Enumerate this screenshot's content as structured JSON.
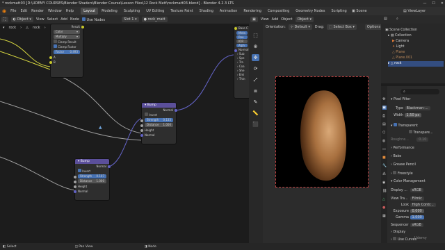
{
  "window": {
    "title": "* rockmatt03 [D:\\UDEMY COURSES\\Blender Shaders\\Blender Course\\Lesson Files\\12 Rock Matt\\rockmatt03.blend] - Blender 4.2.3 LTS",
    "min": "—",
    "max": "☐",
    "close": "✕"
  },
  "menu": {
    "items": [
      "File",
      "Edit",
      "Render",
      "Window",
      "Help"
    ],
    "workspaces": [
      "Layout",
      "Modeling",
      "Sculpting",
      "UV Editing",
      "Texture Paint",
      "Shading",
      "Animation",
      "Rendering",
      "Compositing",
      "Geometry Nodes",
      "Scripting"
    ],
    "scene": "Scene",
    "view_layer": "ViewLayer"
  },
  "node_header": {
    "editor": "Object",
    "view": "View",
    "select": "Select",
    "add": "Add",
    "node": "Node",
    "use_nodes": "Use Nodes",
    "slot": "Slot 1",
    "material": "rock_matt",
    "breadcrumb_obj": "rock",
    "breadcrumb_mesh": "rock",
    "breadcrumb_mat": "rock_matt"
  },
  "mix_node": {
    "header": "Result",
    "data_type": "Color",
    "blend": "Multiply",
    "clamp_result": "Clamp Result",
    "clamp_factor": "Clamp Factor",
    "factor_label": "Factor",
    "factor_value": "0.493",
    "in_a": "A",
    "in_b": "B"
  },
  "bump1": {
    "title": "Bump",
    "normal_out": "Normal",
    "invert": "Invert",
    "strength_label": "Strength",
    "strength_value": "0.133",
    "distance_label": "Distance",
    "distance_value": "1.000",
    "height": "Height",
    "normal_in": "Normal"
  },
  "bump2": {
    "title": "Bump",
    "normal_out": "Normal",
    "invert": "Invert",
    "strength_label": "Strength",
    "strength_value": "0.107",
    "distance_label": "Distance",
    "distance_value": "1.000",
    "height": "Height",
    "normal_in": "Normal"
  },
  "bsdf_partial": {
    "header": "Base C",
    "rows": [
      "Meta",
      "Rou",
      "IOR",
      "Alph",
      "Normal",
      "Sub",
      "Spe",
      "Tra",
      "Coa",
      "She",
      "Emi",
      "Thin"
    ]
  },
  "viewport_header": {
    "orientation_label": "Orientation:",
    "orientation": "Default",
    "drag_label": "Drag:",
    "drag": "Select Box",
    "options": "Options",
    "view": "View",
    "add": "Add",
    "object": "Object",
    "shading_mode": "Object"
  },
  "outliner": {
    "header": "Scene Collection",
    "items": [
      {
        "name": "Collection",
        "icon": "collection-icon"
      },
      {
        "name": "Camera",
        "icon": "camera-icon"
      },
      {
        "name": "Light",
        "icon": "light-icon"
      },
      {
        "name": "Plane",
        "icon": "mesh-icon"
      },
      {
        "name": "Plane.001",
        "icon": "mesh-icon"
      },
      {
        "name": "rock",
        "icon": "mesh-icon"
      }
    ]
  },
  "properties": {
    "search_placeholder": "",
    "pixel_filter": "Pixel Filter",
    "type_label": "Type",
    "type_value": "Blackman-...",
    "width_label": "Width",
    "width_value": "1.50 px",
    "film": "Film",
    "transparent": "Transparent",
    "transparent_glass": "Transpare...",
    "roughness_label": "Roughne...",
    "roughness_value": "0.10",
    "performance": "Performance",
    "bake": "Bake",
    "grease_pencil": "Grease Pencil",
    "freestyle": "Freestyle",
    "color_management": "Color Management",
    "display_label": "Display ...",
    "display_value": "sRGB",
    "view_transform_label": "View Tra...",
    "view_transform_value": "Filmic",
    "look_label": "Look",
    "look_value": "High Contr...",
    "exposure_label": "Exposure",
    "exposure_value": "0.000",
    "gamma_label": "Gamma",
    "gamma_value": "1.000",
    "sequencer_label": "Sequencer",
    "sequencer_value": "sRGB",
    "display": "Display",
    "use_curves": "Use Curves"
  },
  "status": {
    "select": "Select",
    "pan_view": "Pan View",
    "node": "Node",
    "watermark": "Udemy"
  },
  "colors": {
    "accent": "#4772b3",
    "node_header": "#5b4f9a",
    "socket_purple": "#6363c7",
    "socket_gray": "#a1a1a1",
    "socket_yellow": "#c7c729",
    "link_purple": "#6666cc",
    "link_yellow": "#d8d840",
    "rock_dark": "#3a2314",
    "rock_light": "#d9a877"
  }
}
